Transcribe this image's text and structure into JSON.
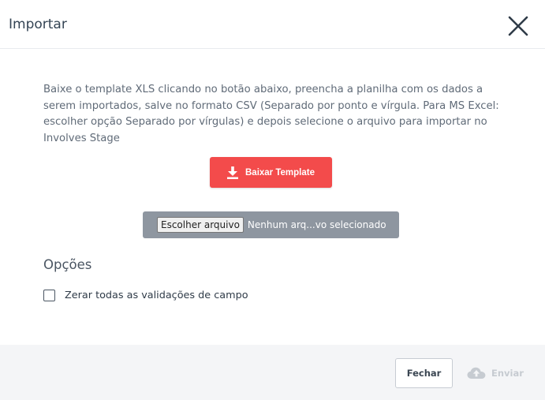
{
  "dialog": {
    "title": "Importar",
    "description": "Baixe o template XLS clicando no botão abaixo, preencha a planilha com os dados a serem importados, salve no formato CSV (Separado por ponto e vírgula. Para MS Excel: escolher opção Separado por vírgulas) e depois selecione o arquivo para importar no Involves Stage",
    "download_button": "Baixar Template",
    "file_input": {
      "choose_label": "Escolher arquivo",
      "status": "Nenhum arq...vo selecionado"
    },
    "options": {
      "title": "Opções",
      "reset_validations_label": "Zerar todas as validações de campo",
      "reset_validations_checked": false
    },
    "footer": {
      "close_label": "Fechar",
      "send_label": "Enviar"
    }
  },
  "colors": {
    "download_button": "#f34b4b",
    "file_box": "#8e96a0",
    "footer_bg": "#f4f5f7",
    "send_disabled": "#c6cbd1"
  },
  "icons": {
    "close": "close-icon",
    "download": "download-icon",
    "upload": "cloud-upload-icon"
  }
}
